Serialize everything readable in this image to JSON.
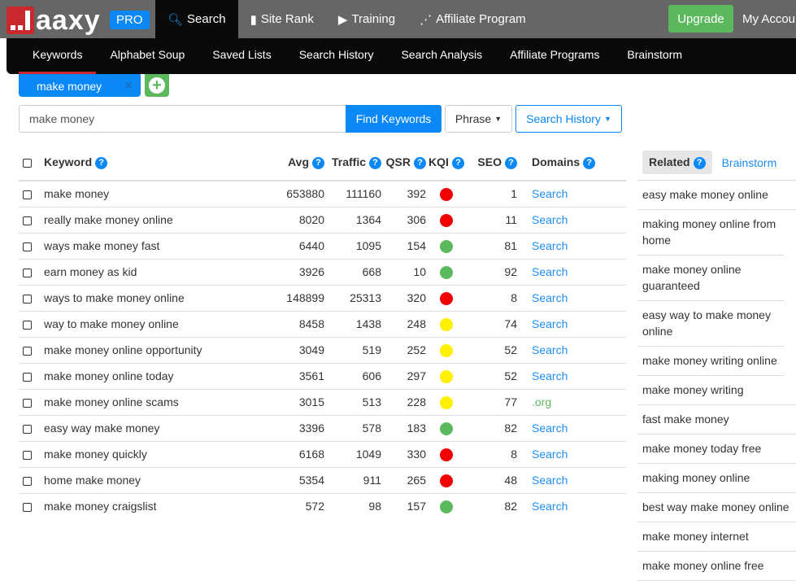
{
  "header": {
    "logo": "aaxy",
    "badge": "PRO",
    "nav": [
      {
        "label": "Search",
        "icon": "search-icon",
        "active": true
      },
      {
        "label": "Site Rank",
        "icon": "bar-chart-icon"
      },
      {
        "label": "Training",
        "icon": "play-circle-icon"
      },
      {
        "label": "Affiliate Program",
        "icon": "share-icon"
      }
    ],
    "upgrade": "Upgrade",
    "account": "My Account"
  },
  "subnav": [
    "Keywords",
    "Alphabet Soup",
    "Saved Lists",
    "Search History",
    "Search Analysis",
    "Affiliate Programs",
    "Brainstorm"
  ],
  "tag": {
    "label": "make money",
    "close": "×"
  },
  "search": {
    "value": "make money",
    "find": "Find Keywords",
    "phrase": "Phrase",
    "history": "Search History"
  },
  "colors": {
    "red": "#f00000",
    "green": "#5cb85c",
    "yellow": "#ffef00",
    "accent": "#0a88f5"
  },
  "table": {
    "headers": [
      "Keyword",
      "Avg",
      "Traffic",
      "QSR",
      "KQI",
      "SEO",
      "Domains"
    ],
    "rows": [
      [
        "make money",
        "653880",
        "111160",
        "392",
        "red",
        "1",
        "Search"
      ],
      [
        "really make money online",
        "8020",
        "1364",
        "306",
        "red",
        "11",
        "Search"
      ],
      [
        "ways make money fast",
        "6440",
        "1095",
        "154",
        "green",
        "81",
        "Search"
      ],
      [
        "earn money as kid",
        "3926",
        "668",
        "10",
        "green",
        "92",
        "Search"
      ],
      [
        "ways to make money online",
        "148899",
        "25313",
        "320",
        "red",
        "8",
        "Search"
      ],
      [
        "way to make money online",
        "8458",
        "1438",
        "248",
        "yellow",
        "74",
        "Search"
      ],
      [
        "make money online opportunity",
        "3049",
        "519",
        "252",
        "yellow",
        "52",
        "Search"
      ],
      [
        "make money online today",
        "3561",
        "606",
        "297",
        "yellow",
        "52",
        "Search"
      ],
      [
        "make money online scams",
        "3015",
        "513",
        "228",
        "yellow",
        "77",
        ".org"
      ],
      [
        "easy way make money",
        "3396",
        "578",
        "183",
        "green",
        "82",
        "Search"
      ],
      [
        "make money quickly",
        "6168",
        "1049",
        "330",
        "red",
        "8",
        "Search"
      ],
      [
        "home make money",
        "5354",
        "911",
        "265",
        "red",
        "48",
        "Search"
      ],
      [
        "make money craigslist",
        "572",
        "98",
        "157",
        "green",
        "82",
        "Search"
      ]
    ]
  },
  "related": {
    "tabs": [
      "Related",
      "Brainstorm"
    ],
    "items": [
      "easy make money online",
      "making money online from home",
      "make money online guaranteed",
      "easy way to make money online",
      "make money writing online",
      "make money writing",
      "fast make money",
      "make money today free",
      "making money online",
      "best way make money online",
      "make money internet",
      "make money online free"
    ]
  }
}
